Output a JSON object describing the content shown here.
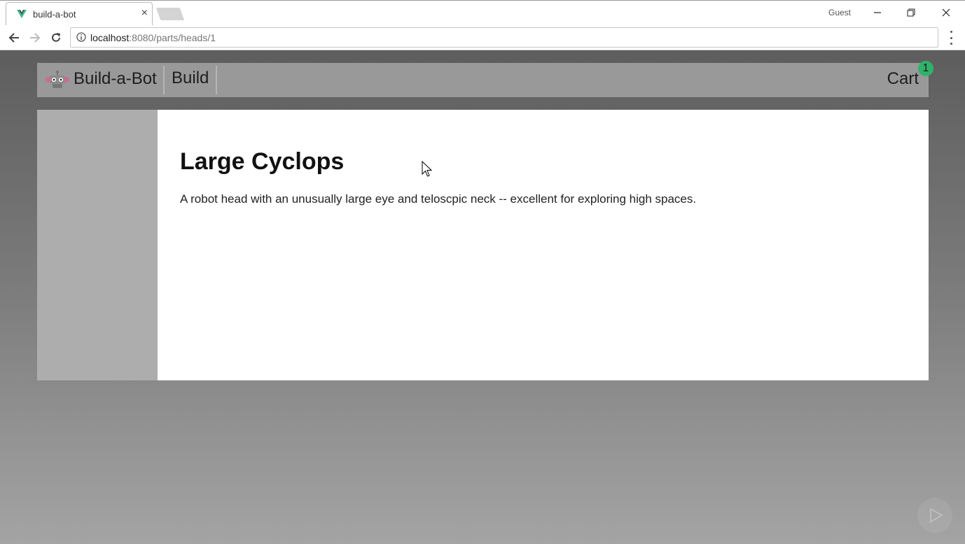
{
  "browser": {
    "tab_title": "build-a-bot",
    "tab_close": "×",
    "profile_label": "Guest",
    "url_host": "localhost",
    "url_path": ":8080/parts/heads/1"
  },
  "app": {
    "brand": "Build-a-Bot",
    "nav_build": "Build",
    "nav_cart": "Cart",
    "cart_count": "1"
  },
  "part": {
    "title": "Large Cyclops",
    "description": "A robot head with an unusually large eye and teloscpic neck -- excellent for exploring high spaces."
  },
  "colors": {
    "header_bg": "#999999",
    "sidebar_bg": "#adadad",
    "badge_green": "#2fb36b"
  },
  "icons": [
    "vue-favicon-icon",
    "back-arrow-icon",
    "forward-arrow-icon",
    "reload-icon",
    "info-icon",
    "more-menu-icon",
    "robot-logo-icon",
    "play-watermark-icon"
  ]
}
